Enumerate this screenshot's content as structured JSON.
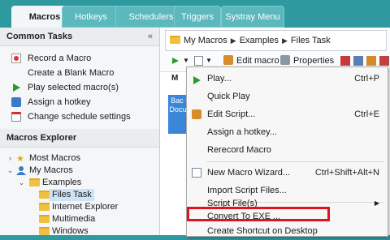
{
  "tabs": [
    "Macros",
    "Hotkeys",
    "Schedulers",
    "Triggers",
    "Systray Menu"
  ],
  "common_tasks": {
    "title": "Common Tasks",
    "items": [
      "Record a Macro",
      "Create a Blank Macro",
      "Play selected macro(s)",
      "Assign a hotkey",
      "Change schedule settings"
    ]
  },
  "explorer": {
    "title": "Macros Explorer",
    "tree": [
      "Most Macros",
      "My Macros",
      "Examples",
      "Files Task",
      "Internet Explorer",
      "Multimedia",
      "Windows"
    ]
  },
  "breadcrumb": [
    "My Macros",
    "Examples",
    "Files Task"
  ],
  "toolbar": {
    "edit": "Edit macro",
    "properties": "Properties"
  },
  "content": {
    "col_head": "M",
    "tile_text": "Bac Of Docu Fi"
  },
  "menu": {
    "items": [
      {
        "label": "Play...",
        "shortcut": "Ctrl+P"
      },
      {
        "label": "Quick Play",
        "shortcut": ""
      },
      {
        "label": "Edit Script...",
        "shortcut": "Ctrl+E"
      },
      {
        "label": "Assign a hotkey...",
        "shortcut": ""
      },
      {
        "label": "Rerecord Macro",
        "shortcut": ""
      },
      {
        "label": "New Macro Wizard...",
        "shortcut": "Ctrl+Shift+Alt+N"
      },
      {
        "label": "Import Script Files...",
        "shortcut": ""
      },
      {
        "label": "Script File(s)",
        "shortcut": ""
      },
      {
        "label": "Convert To EXE ...",
        "shortcut": ""
      },
      {
        "label": "Create Shortcut on Desktop",
        "shortcut": ""
      }
    ]
  },
  "colors": {
    "accent": "#2e9aa0",
    "highlight": "#e0151c",
    "tile": "#3a86d8"
  }
}
